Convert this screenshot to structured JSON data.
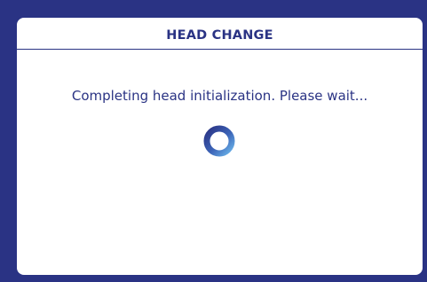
{
  "dialog": {
    "title": "HEAD CHANGE",
    "message": "Completing head initialization. Please wait..."
  },
  "spinner": {
    "icon": "loading-spinner-icon",
    "colors": {
      "dark": "#2a3384",
      "light": "#5fa9e3"
    }
  },
  "colors": {
    "background": "#2a3384",
    "panel": "#ffffff",
    "text": "#2a3384"
  }
}
